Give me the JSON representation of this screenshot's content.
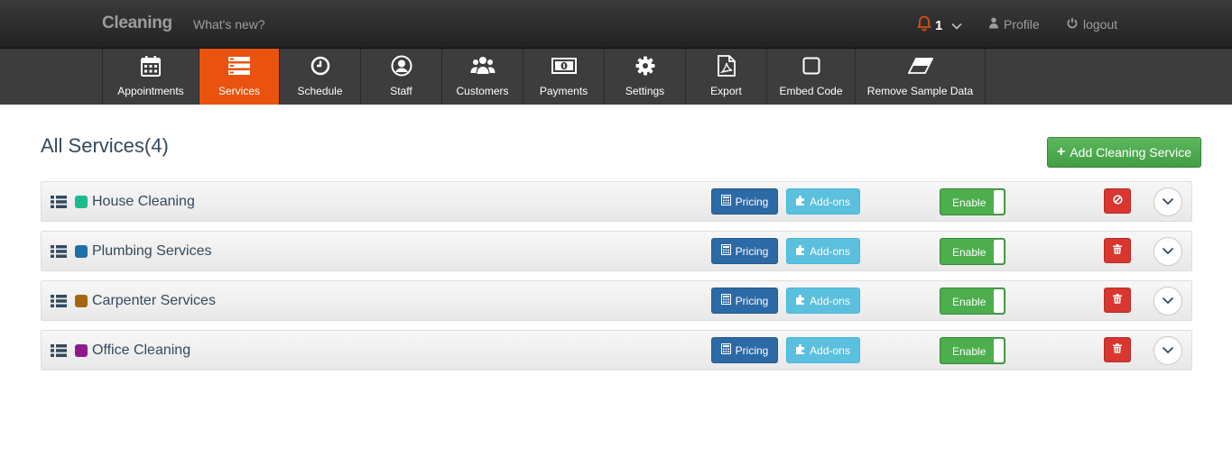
{
  "header": {
    "brand": "Cleaning",
    "whats_new": "What's new?",
    "notification_count": "1",
    "profile_label": "Profile",
    "logout_label": "logout"
  },
  "nav": {
    "items": [
      {
        "label": "Appointments",
        "icon": "calendar-icon"
      },
      {
        "label": "Services",
        "icon": "services-list-icon",
        "active": true
      },
      {
        "label": "Schedule",
        "icon": "clock-icon"
      },
      {
        "label": "Staff",
        "icon": "user-circle-icon"
      },
      {
        "label": "Customers",
        "icon": "users-icon"
      },
      {
        "label": "Payments",
        "icon": "money-icon"
      },
      {
        "label": "Settings",
        "icon": "gear-icon"
      },
      {
        "label": "Export",
        "icon": "pdf-file-icon"
      },
      {
        "label": "Embed Code",
        "icon": "square-icon"
      },
      {
        "label": "Remove Sample Data",
        "icon": "eraser-icon"
      }
    ]
  },
  "main": {
    "title": "All Services(4)",
    "add_button_label": "Add Cleaning Service"
  },
  "services": [
    {
      "name": "House Cleaning",
      "color": "#1abc8c",
      "pricing_label": "Pricing",
      "addons_label": "Add-ons",
      "toggle_label": "Enable",
      "delete_icon": "ban-icon"
    },
    {
      "name": "Plumbing Services",
      "color": "#1f6fa8",
      "pricing_label": "Pricing",
      "addons_label": "Add-ons",
      "toggle_label": "Enable",
      "delete_icon": "trash-icon"
    },
    {
      "name": "Carpenter Services",
      "color": "#a3680f",
      "pricing_label": "Pricing",
      "addons_label": "Add-ons",
      "toggle_label": "Enable",
      "delete_icon": "trash-icon"
    },
    {
      "name": "Office Cleaning",
      "color": "#8e1a8e",
      "pricing_label": "Pricing",
      "addons_label": "Add-ons",
      "toggle_label": "Enable",
      "delete_icon": "trash-icon"
    }
  ],
  "colors": {
    "accent": "#e9530f",
    "primary": "#2c6aa5",
    "info": "#5bc0de",
    "success": "#4cae4c",
    "danger": "#d9362f"
  }
}
